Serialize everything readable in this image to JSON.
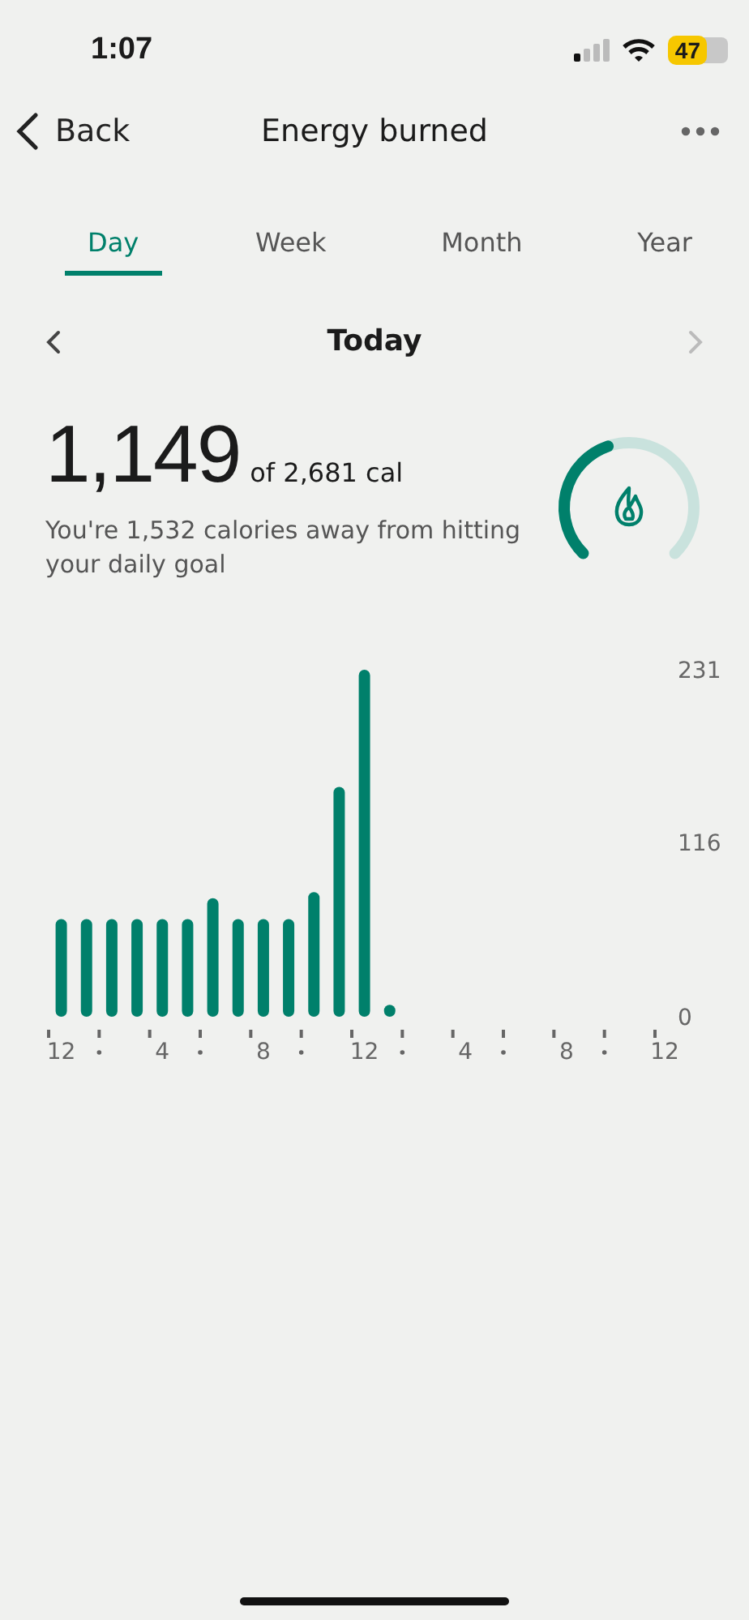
{
  "status_bar": {
    "time": "1:07",
    "battery": "47"
  },
  "nav": {
    "back": "Back",
    "title": "Energy burned"
  },
  "tabs": [
    {
      "label": "Day",
      "selected": true
    },
    {
      "label": "Week",
      "selected": false
    },
    {
      "label": "Month",
      "selected": false
    },
    {
      "label": "Year",
      "selected": false
    }
  ],
  "date_nav": {
    "label": "Today",
    "next_disabled": true
  },
  "summary": {
    "value": "1,149",
    "goal": "of 2,681 cal",
    "message": "You're 1,532 calories away from hitting your daily goal"
  },
  "chart": {
    "end_label": "12",
    "chart_data": {
      "type": "bar",
      "categories": [
        "12",
        null,
        null,
        null,
        "4",
        null,
        null,
        null,
        "8",
        null,
        null,
        null,
        "12",
        null,
        null,
        null,
        "4",
        null,
        null,
        null,
        "8",
        null,
        null,
        null
      ],
      "values": [
        65,
        65,
        65,
        65,
        65,
        65,
        79,
        65,
        65,
        65,
        83,
        153,
        231,
        8,
        null,
        null,
        null,
        null,
        null,
        null,
        null,
        null,
        null,
        null
      ],
      "ylim": [
        0,
        231
      ],
      "yticks": [
        {
          "value": 231,
          "label": "231"
        },
        {
          "value": 116,
          "label": "116"
        },
        {
          "value": 0,
          "label": "0"
        }
      ]
    }
  }
}
